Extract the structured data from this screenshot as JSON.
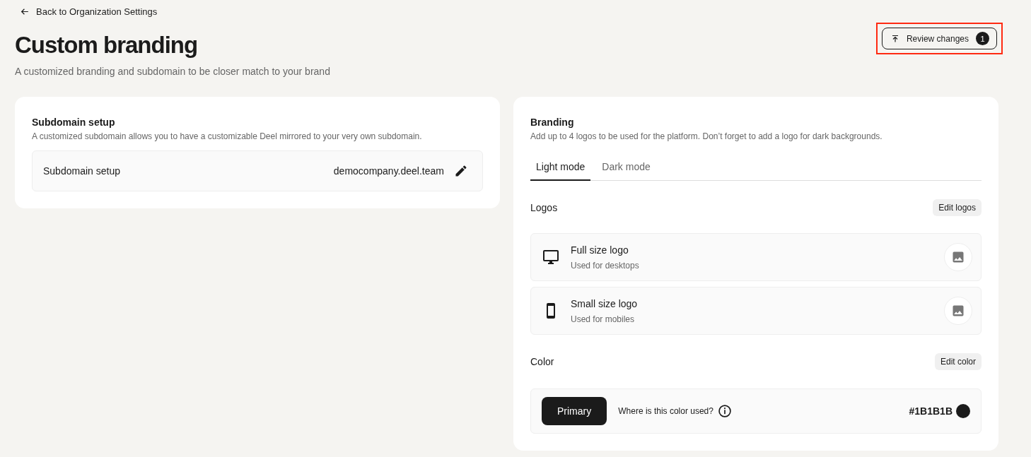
{
  "back_link": {
    "label": "Back to Organization Settings"
  },
  "header": {
    "title": "Custom branding",
    "subtitle": "A customized branding and subdomain to be closer match to your brand",
    "review_button": {
      "label": "Review changes",
      "badge": "1",
      "highlighted": true
    }
  },
  "subdomain_card": {
    "title": "Subdomain setup",
    "description": "A customized subdomain allows you to have a customizable Deel mirrored to your very own subdomain.",
    "row": {
      "label": "Subdomain setup",
      "value": "democompany.deel.team"
    }
  },
  "branding_card": {
    "title": "Branding",
    "description": "Add up to 4 logos to be used for the platform. Don’t forget to add a logo for dark backgrounds.",
    "tabs": [
      {
        "label": "Light mode",
        "selected": true
      },
      {
        "label": "Dark mode",
        "selected": false
      }
    ],
    "logos": {
      "title": "Logos",
      "button": "Edit logos",
      "items": [
        {
          "kind": "desktop",
          "title": "Full size logo",
          "subtitle": "Used for desktops"
        },
        {
          "kind": "mobile",
          "title": "Small size logo",
          "subtitle": "Used for mobiles"
        }
      ]
    },
    "color": {
      "title": "Color",
      "button": "Edit color",
      "entry": {
        "label": "Primary",
        "question": "Where is this color used?",
        "hex": "#1B1B1B",
        "color": "#1b1b1b"
      }
    }
  }
}
